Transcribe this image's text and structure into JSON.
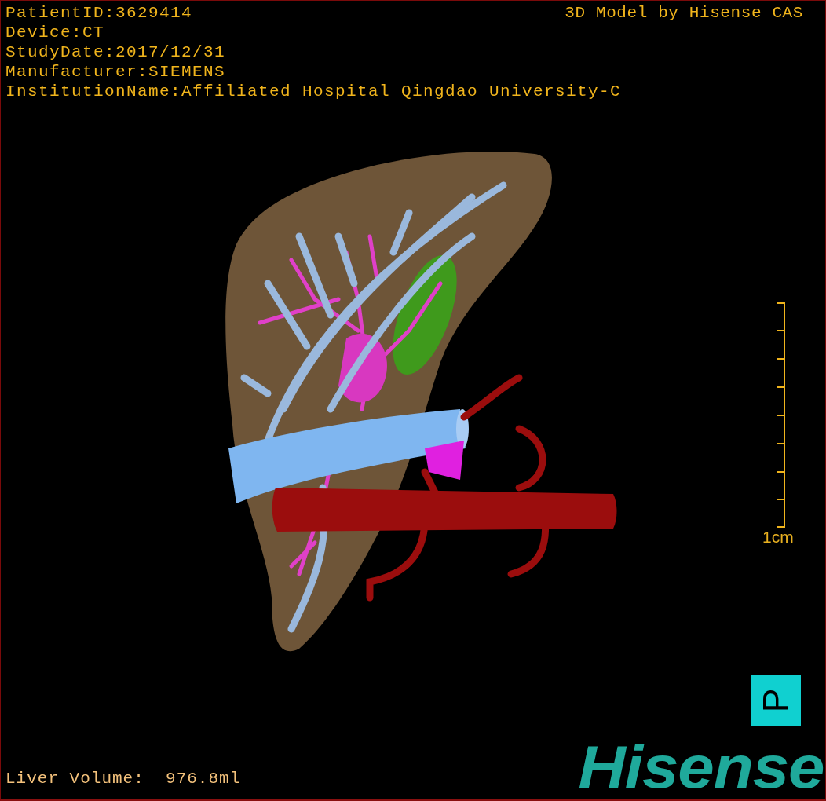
{
  "info_lines": [
    "PatientID:3629414",
    "Device:CT",
    "StudyDate:2017/12/31",
    "Manufacturer:SIEMENS",
    "InstitutionName:Affiliated Hospital Qingdao University-C"
  ],
  "model_credit": "3D Model by Hisense CAS",
  "scale_label": "1cm",
  "orientation_marker": "P",
  "liver_volume": "Liver Volume:  976.8ml",
  "logo": "Hisense"
}
